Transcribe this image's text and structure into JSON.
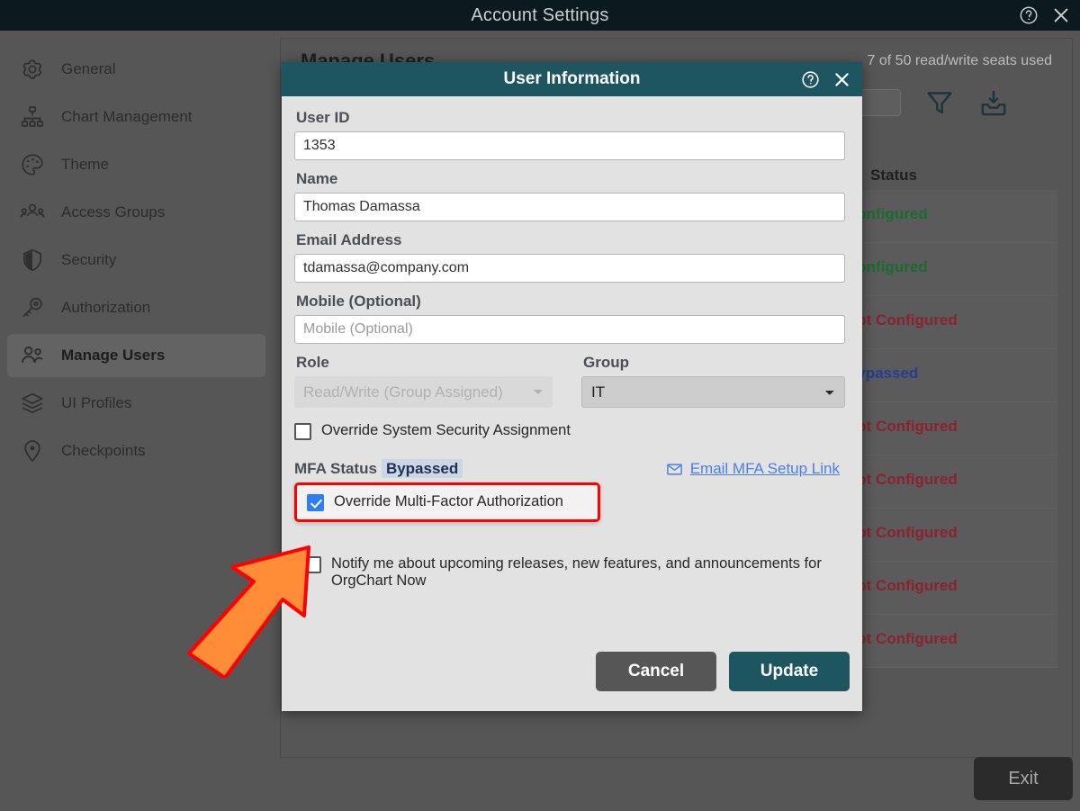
{
  "window": {
    "title": "Account Settings",
    "help_icon": "help-circle-icon",
    "close_icon": "close-icon"
  },
  "sidebar": {
    "items": [
      {
        "label": "General",
        "icon": "gear-icon",
        "active": false
      },
      {
        "label": "Chart Management",
        "icon": "org-chart-icon",
        "active": false
      },
      {
        "label": "Theme",
        "icon": "palette-icon",
        "active": false
      },
      {
        "label": "Access Groups",
        "icon": "user-group-icon",
        "active": false
      },
      {
        "label": "Security",
        "icon": "shield-icon",
        "active": false
      },
      {
        "label": "Authorization",
        "icon": "key-icon",
        "active": false
      },
      {
        "label": "Manage Users",
        "icon": "users-icon",
        "active": true
      },
      {
        "label": "UI Profiles",
        "icon": "layers-icon",
        "active": false
      },
      {
        "label": "Checkpoints",
        "icon": "map-pin-icon",
        "active": false
      }
    ]
  },
  "main": {
    "page_title": "Manage Users",
    "seats_text": "7 of 50 read/write seats used",
    "search_placeholder": "",
    "filter_icon": "filter-icon",
    "export_icon": "download-icon",
    "status_column_header": "Status",
    "rows": [
      {
        "status": "Configured",
        "status_color": "green"
      },
      {
        "status": "Configured",
        "status_color": "green"
      },
      {
        "status": "Not Configured",
        "status_color": "red"
      },
      {
        "status": "Bypassed",
        "status_color": "blue"
      },
      {
        "status": "Not Configured",
        "status_color": "red"
      },
      {
        "status": "Not Configured",
        "status_color": "red"
      },
      {
        "status": "Not Configured",
        "status_color": "red"
      },
      {
        "status": "Not Configured",
        "status_color": "red"
      },
      {
        "status": "Not Configured",
        "status_color": "red"
      }
    ],
    "exit_label": "Exit"
  },
  "dialog": {
    "title": "User Information",
    "help_icon": "help-circle-icon",
    "close_icon": "close-icon",
    "fields": {
      "user_id_label": "User ID",
      "user_id_value": "1353",
      "name_label": "Name",
      "name_value": "Thomas Damassa",
      "email_label": "Email Address",
      "email_value": "tdamassa@company.com",
      "mobile_label": "Mobile (Optional)",
      "mobile_value": "",
      "mobile_placeholder": "Mobile (Optional)",
      "role_label": "Role",
      "role_value": "Read/Write (Group Assigned)",
      "group_label": "Group",
      "group_value": "IT"
    },
    "override_security_label": "Override System Security Assignment",
    "override_security_checked": false,
    "mfa_status_label": "MFA Status",
    "mfa_status_value": "Bypassed",
    "email_mfa_link": "Email MFA Setup Link",
    "mail_icon": "envelope-icon",
    "override_mfa_label": "Override Multi-Factor Authorization",
    "override_mfa_checked": true,
    "notify_label": "Notify me about upcoming releases, new features, and announcements for OrgChart Now",
    "notify_checked": false,
    "cancel_label": "Cancel",
    "update_label": "Update"
  },
  "annotation": {
    "arrow_icon": "pointer-arrow-icon",
    "arrow_color": "#FF8C36",
    "highlight_color": "#FF0000"
  },
  "colors": {
    "titlebar": "#0C1A1F",
    "teal": "#1D5561",
    "sidebar": "#565656",
    "link_blue": "#4A7FE8",
    "checkbox_blue": "#2F7DF4",
    "status_green": "#1B6B2E",
    "status_red": "#8A2230",
    "status_blue": "#23408F"
  }
}
